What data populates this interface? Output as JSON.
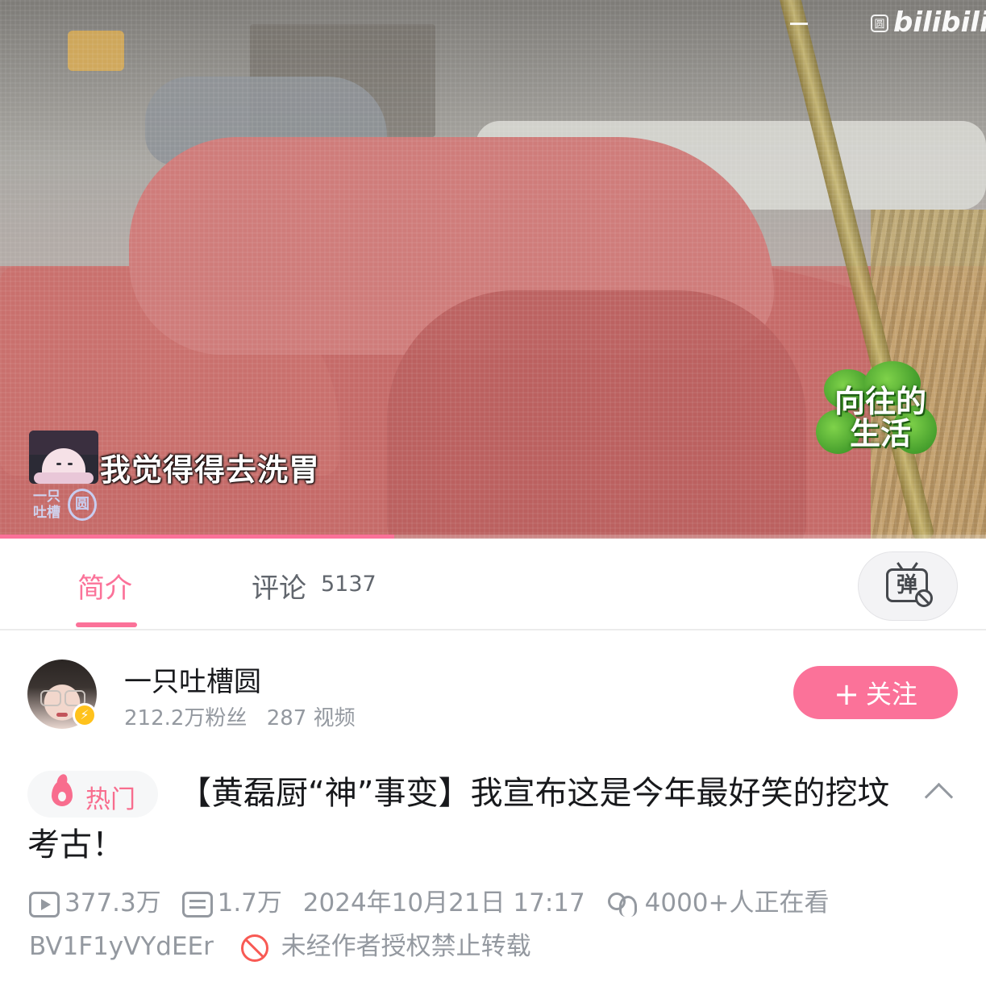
{
  "video": {
    "watermark_brand": "bilibili",
    "watermark_icon": "bilibili-logo-icon",
    "subtitle": "我觉得得去洗胃",
    "uploader_mark": {
      "text": "一只吐槽",
      "circle_glyph": "圆"
    },
    "show_logo_text": "向往的生活",
    "progress_fraction": 0.4,
    "colors": {
      "progress": "#fb7299"
    }
  },
  "tabs": {
    "intro_label": "简介",
    "comments_label": "评论",
    "comments_count": "5137",
    "danmaku_toggle_glyph": "弹",
    "danmaku_toggle_icon": "danmaku-off-icon"
  },
  "uploader": {
    "name": "一只吐槽圆",
    "followers": "212.2万粉丝",
    "videos": "287 视频",
    "badge_icon": "lightning-icon",
    "follow_label": "关注",
    "follow_plus": "+"
  },
  "video_info": {
    "hot_label": "热门",
    "title": "【黄磊厨“神”事变】我宣布这是今年最好笑的挖坟考古！",
    "views": "377.3万",
    "danmaku_count": "1.7万",
    "publish_time": "2024年10月21日 17:17",
    "watching": "4000+人正在看",
    "bvid": "BV1F1yVYdEEr",
    "copyright_notice": "未经作者授权禁止转载"
  },
  "colors": {
    "accent": "#fb7299",
    "hot": "#f86d8e",
    "muted": "#9499a0",
    "forbid": "#f85a54"
  }
}
